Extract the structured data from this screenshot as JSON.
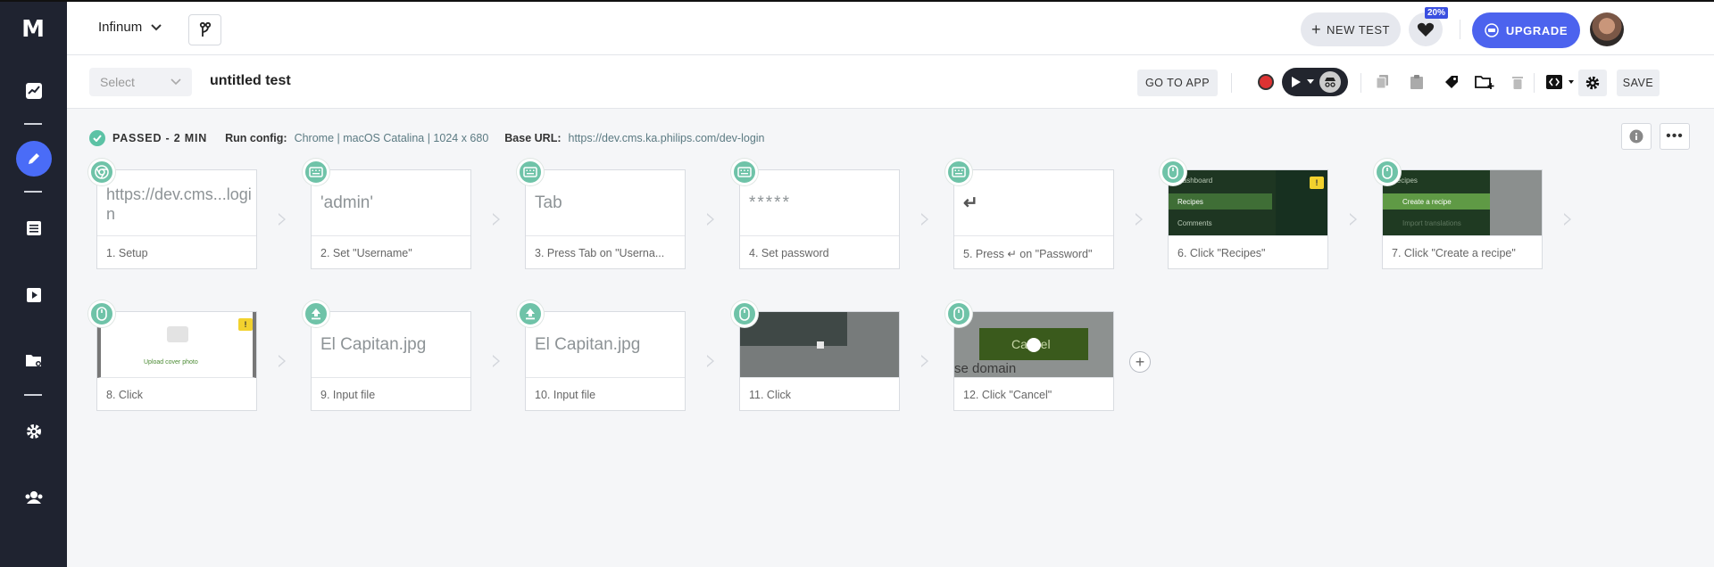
{
  "app": {
    "logo": "M"
  },
  "sidebar": {
    "items": [
      "activity-icon",
      "edit-icon",
      "list-icon",
      "play-icon",
      "folder-gear-icon",
      "settings-icon",
      "team-icon"
    ]
  },
  "topbar": {
    "org": "Infinum",
    "new_test": "NEW TEST",
    "badge": "20%",
    "upgrade": "UPGRADE"
  },
  "toolbar": {
    "select_placeholder": "Select",
    "test_name": "untitled test",
    "go_to_app": "GO TO APP",
    "save": "SAVE"
  },
  "status": {
    "result": "PASSED - 2 MIN",
    "run_config_label": "Run config:",
    "run_config": "Chrome | macOS Catalina | 1024 x 680",
    "base_url_label": "Base URL:",
    "base_url": "https://dev.cms.ka.philips.com/dev-login"
  },
  "steps": [
    {
      "preview": "https://dev.cms...login",
      "caption": "1. Setup",
      "icon": "chrome-icon"
    },
    {
      "preview": "'admin'",
      "caption": "2. Set \"Username\"",
      "icon": "keyboard-icon"
    },
    {
      "preview": "Tab",
      "caption": "3. Press Tab on \"Userna...",
      "icon": "keyboard-icon"
    },
    {
      "preview": "*****",
      "caption": "4. Set password",
      "icon": "keyboard-icon"
    },
    {
      "preview": "↵",
      "caption": "5. Press ↵ on \"Password\"",
      "icon": "keyboard-icon"
    },
    {
      "preview": "",
      "caption": "6. Click \"Recipes\"",
      "icon": "mouse-icon"
    },
    {
      "preview": "",
      "caption": "7. Click \"Create a recipe\"",
      "icon": "mouse-icon"
    },
    {
      "preview": "",
      "caption": "8. Click",
      "icon": "mouse-icon"
    },
    {
      "preview": "El Capitan.jpg",
      "caption": "9. Input file",
      "icon": "upload-icon"
    },
    {
      "preview": "El Capitan.jpg",
      "caption": "10. Input file",
      "icon": "upload-icon"
    },
    {
      "preview": "",
      "caption": "11. Click",
      "icon": "mouse-icon"
    },
    {
      "preview": "",
      "caption": "12. Click \"Cancel\"",
      "icon": "mouse-icon"
    }
  ],
  "thumbs": {
    "recipes_menu": [
      "Dashboard",
      "Recipes",
      "Comments"
    ],
    "create_menu": [
      "Recipes",
      "Create a recipe",
      "Import translations"
    ],
    "upload_label": "Upload cover photo",
    "cancel_label": "Cancel",
    "cancel_bg_text": "se domain"
  }
}
